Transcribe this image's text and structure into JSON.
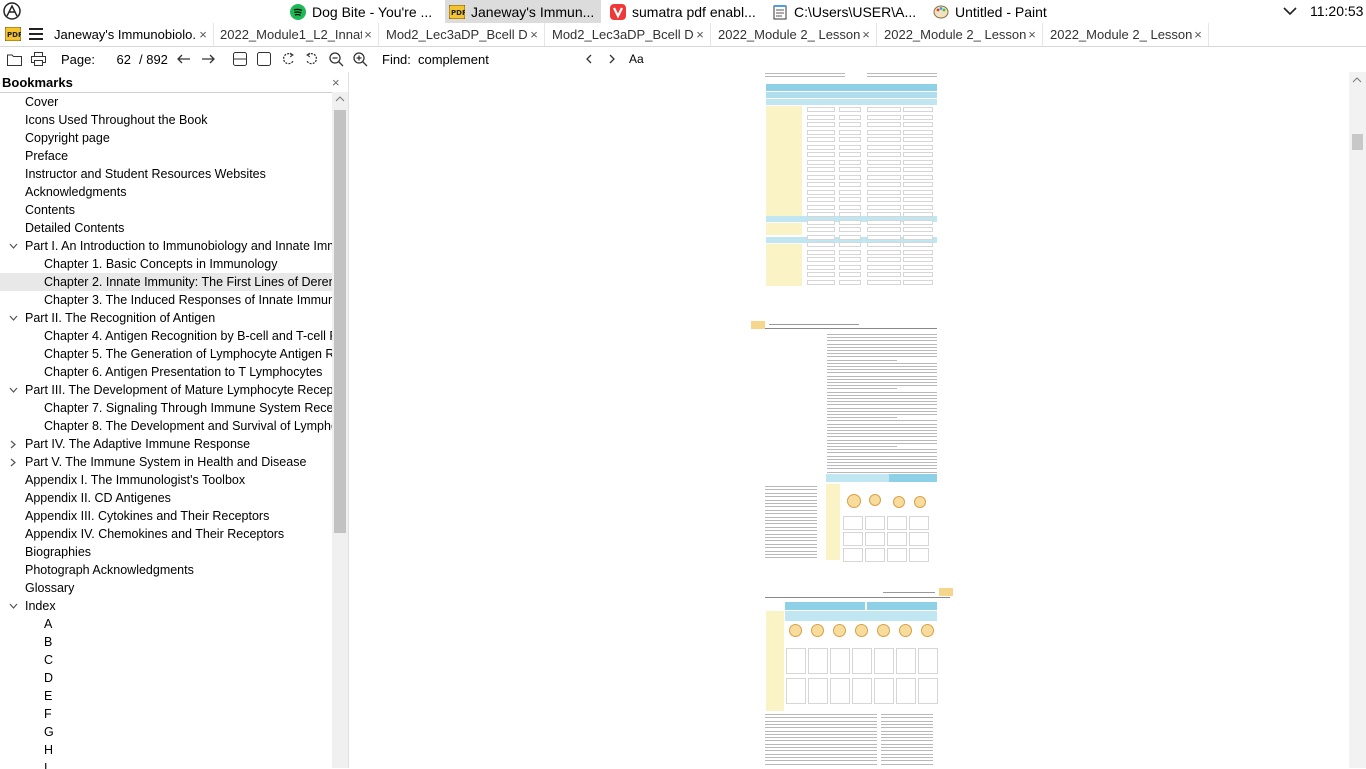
{
  "system_bar": {
    "apps": [
      {
        "label": "Dog Bite - You're ...",
        "icon": "spotify-icon",
        "active": false
      },
      {
        "label": "Janeway's Immun...",
        "icon": "sumatra-pdf-icon",
        "active": true
      },
      {
        "label": "sumatra pdf enabl...",
        "icon": "vivaldi-icon",
        "active": false
      },
      {
        "label": "C:\\Users\\USER\\A...",
        "icon": "notepad-icon",
        "active": false
      },
      {
        "label": "Untitled - Paint",
        "icon": "paint-icon",
        "active": false
      }
    ],
    "clock": "11:20:53"
  },
  "tabs": [
    {
      "title": "Janeway's  Immunobiolo...",
      "close": "×",
      "active": true
    },
    {
      "title": "2022_Module1_L2_Innat...",
      "close": "×",
      "active": false
    },
    {
      "title": "Mod2_Lec3aDP_Bcell  D...",
      "close": "×",
      "active": false
    },
    {
      "title": "Mod2_Lec3aDP_Bcell  D...",
      "close": "×",
      "active": false
    },
    {
      "title": "2022_Module 2_ Lesson...",
      "close": "×",
      "active": false
    },
    {
      "title": "2022_Module 2_ Lesson...",
      "close": "×",
      "active": false
    },
    {
      "title": "2022_Module 2_ Lesson...",
      "close": "×",
      "active": false
    }
  ],
  "toolbar": {
    "page_label": "Page:",
    "page_value": "62",
    "page_total": "/ 892",
    "find_label": "Find:",
    "find_value": "complement",
    "match_case_label": "Aa"
  },
  "bookmarks": {
    "title": "Bookmarks",
    "close": "×",
    "items": [
      {
        "label": "Cover",
        "level": 0,
        "toggle": ""
      },
      {
        "label": "Icons Used Throughout the Book",
        "level": 0,
        "toggle": ""
      },
      {
        "label": "Copyright page",
        "level": 0,
        "toggle": ""
      },
      {
        "label": "Preface",
        "level": 0,
        "toggle": ""
      },
      {
        "label": "Instructor and Student Resources Websites",
        "level": 0,
        "toggle": ""
      },
      {
        "label": "Acknowledgments",
        "level": 0,
        "toggle": ""
      },
      {
        "label": "Contents",
        "level": 0,
        "toggle": ""
      },
      {
        "label": "Detailed Contents",
        "level": 0,
        "toggle": ""
      },
      {
        "label": "Part I. An Introduction to Immunobiology and Innate Imm",
        "level": 0,
        "toggle": "expanded"
      },
      {
        "label": "Chapter 1. Basic Concepts in Immunology",
        "level": 1,
        "toggle": ""
      },
      {
        "label": "Chapter 2. Innate Immunity: The First Lines of Derense",
        "level": 1,
        "toggle": "",
        "selected": true
      },
      {
        "label": "Chapter 3. The Induced Responses of Innate Immunity",
        "level": 1,
        "toggle": ""
      },
      {
        "label": "Part II. The Recognition of Antigen",
        "level": 0,
        "toggle": "expanded"
      },
      {
        "label": "Chapter 4. Antigen Recognition by B-cell and T-cell Re",
        "level": 1,
        "toggle": ""
      },
      {
        "label": "Chapter 5. The Generation of Lymphocyte Antigen Rec",
        "level": 1,
        "toggle": ""
      },
      {
        "label": "Chapter 6. Antigen Presentation to T Lymphocytes",
        "level": 1,
        "toggle": ""
      },
      {
        "label": "Part III. The Development of Mature Lymphocyte Receptor",
        "level": 0,
        "toggle": "expanded"
      },
      {
        "label": "Chapter 7. Signaling Through Immune System Recepto",
        "level": 1,
        "toggle": ""
      },
      {
        "label": "Chapter 8. The Development and Survival of Lymphocy",
        "level": 1,
        "toggle": ""
      },
      {
        "label": "Part IV. The Adaptive Immune Response",
        "level": 0,
        "toggle": "collapsed"
      },
      {
        "label": "Part V. The Immune System in Health and Disease",
        "level": 0,
        "toggle": "collapsed"
      },
      {
        "label": "Appendix I. The Immunologist's Toolbox",
        "level": 0,
        "toggle": ""
      },
      {
        "label": "Appendix II. CD Antigenes",
        "level": 0,
        "toggle": ""
      },
      {
        "label": "Appendix III. Cytokines and Their Receptors",
        "level": 0,
        "toggle": ""
      },
      {
        "label": "Appendix IV. Chemokines and Their Receptors",
        "level": 0,
        "toggle": ""
      },
      {
        "label": "Biographies",
        "level": 0,
        "toggle": ""
      },
      {
        "label": "Photograph Acknowledgments",
        "level": 0,
        "toggle": ""
      },
      {
        "label": "Glossary",
        "level": 0,
        "toggle": ""
      },
      {
        "label": "Index",
        "level": 0,
        "toggle": "expanded"
      },
      {
        "label": "A",
        "level": 2,
        "toggle": ""
      },
      {
        "label": "B",
        "level": 2,
        "toggle": ""
      },
      {
        "label": "C",
        "level": 2,
        "toggle": ""
      },
      {
        "label": "D",
        "level": 2,
        "toggle": ""
      },
      {
        "label": "E",
        "level": 2,
        "toggle": ""
      },
      {
        "label": "F",
        "level": 2,
        "toggle": ""
      },
      {
        "label": "G",
        "level": 2,
        "toggle": ""
      },
      {
        "label": "H",
        "level": 2,
        "toggle": ""
      },
      {
        "label": "I",
        "level": 2,
        "toggle": ""
      }
    ]
  },
  "document": {
    "page_running_header": "Chapter 2: Innate Immunity: The First Lines of Defense",
    "page_number_left": "40",
    "page_running_footer": "The first lines of defense",
    "page_number_right": "41"
  },
  "colors": {
    "active_app_bg": "#dcdcdc",
    "table_header": "#8ed0e6",
    "table_band": "#bfe6f1",
    "table_yellow": "#faf3c6",
    "page_number_tag": "#f5d68c",
    "spotify_green": "#1db954",
    "vivaldi_red": "#ef3939"
  }
}
